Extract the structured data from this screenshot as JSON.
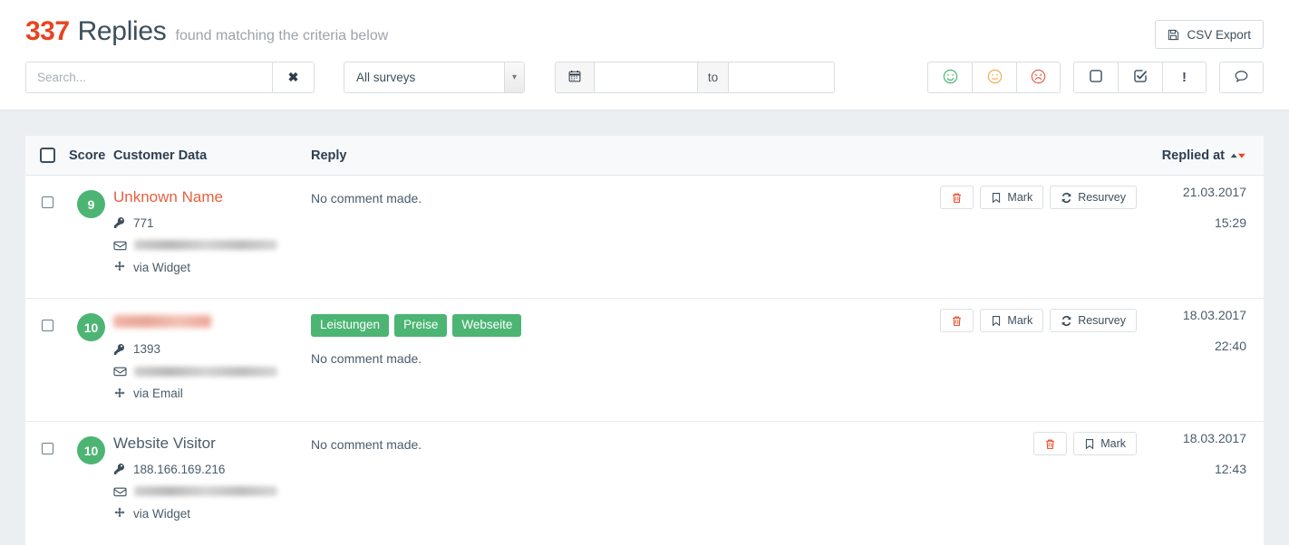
{
  "header": {
    "count": "337",
    "title": "Replies",
    "subtitle": "found matching the criteria below",
    "csv_export_label": "CSV Export",
    "accent_red": "#e8431f",
    "accent_green": "#4cb573",
    "text_dark": "#3d4f5c"
  },
  "filters": {
    "search": {
      "value": "",
      "placeholder": "Search..."
    },
    "clear_label": "✖",
    "survey_select": {
      "selected": "All surveys"
    },
    "date_from": {
      "value": "",
      "placeholder": ""
    },
    "date_to": {
      "value": "",
      "placeholder": ""
    },
    "date_separator": "to",
    "sentiment_buttons": [
      {
        "name": "filter-promoter",
        "icon": "smiley-happy-icon",
        "color": "#4cb573"
      },
      {
        "name": "filter-passive",
        "icon": "smiley-neutral-icon",
        "color": "#f0ad4e"
      },
      {
        "name": "filter-detractor",
        "icon": "smiley-sad-icon",
        "color": "#e8604c"
      }
    ],
    "state_buttons": [
      {
        "name": "filter-unmarked",
        "icon": "square-icon"
      },
      {
        "name": "filter-marked",
        "icon": "check-square-icon"
      },
      {
        "name": "filter-important",
        "icon": "exclamation-icon",
        "label": "!"
      }
    ],
    "comment_button": {
      "name": "filter-has-comment",
      "icon": "comment-icon"
    }
  },
  "table": {
    "columns": {
      "score": "Score",
      "customer_data": "Customer Data",
      "reply": "Reply",
      "replied_at": "Replied at"
    },
    "sort": {
      "column": "replied_at",
      "direction": "desc"
    },
    "rows": [
      {
        "score": "9",
        "name": "Unknown Name",
        "name_style": "link",
        "key": "771",
        "email_blurred": true,
        "source": "via Widget",
        "tags": [],
        "reply": "No comment made.",
        "actions": [
          {
            "name": "delete-button",
            "icon": "trash-icon",
            "label": ""
          },
          {
            "name": "mark-button",
            "icon": "bookmark-icon",
            "label": "Mark"
          },
          {
            "name": "resurvey-button",
            "icon": "refresh-icon",
            "label": "Resurvey"
          }
        ],
        "date": "21.03.2017",
        "time": "15:29"
      },
      {
        "score": "10",
        "name": "",
        "name_style": "blurred",
        "key": "1393",
        "email_blurred": true,
        "source": "via Email",
        "tags": [
          "Leistungen",
          "Preise",
          "Webseite"
        ],
        "reply": "No comment made.",
        "actions": [
          {
            "name": "delete-button",
            "icon": "trash-icon",
            "label": ""
          },
          {
            "name": "mark-button",
            "icon": "bookmark-icon",
            "label": "Mark"
          },
          {
            "name": "resurvey-button",
            "icon": "refresh-icon",
            "label": "Resurvey"
          }
        ],
        "date": "18.03.2017",
        "time": "22:40"
      },
      {
        "score": "10",
        "name": "Website Visitor",
        "name_style": "plain",
        "key": "188.166.169.216",
        "email_blurred": true,
        "source": "via Widget",
        "tags": [],
        "reply": "No comment made.",
        "actions": [
          {
            "name": "delete-button",
            "icon": "trash-icon",
            "label": ""
          },
          {
            "name": "mark-button",
            "icon": "bookmark-icon",
            "label": "Mark"
          }
        ],
        "date": "18.03.2017",
        "time": "12:43"
      }
    ]
  }
}
